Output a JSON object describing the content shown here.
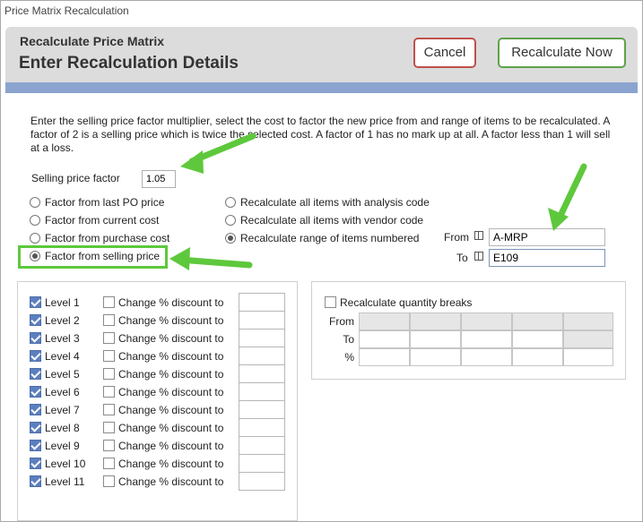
{
  "window": {
    "title": "Price Matrix Recalculation"
  },
  "header": {
    "subtitle": "Recalculate Price Matrix",
    "title": "Enter Recalculation Details",
    "cancel_label": "Cancel",
    "recalc_label": "Recalculate Now"
  },
  "instructions": "Enter the selling price factor multiplier, select the cost to factor the new price from and range of items to be recalculated. A factor of 2 is a selling price which is twice the selected cost. A factor of 1 has no mark up at all. A factor less than 1 will sell at a loss.",
  "selling_price": {
    "label": "Selling price factor",
    "value": "1.05"
  },
  "cost_options": [
    {
      "label": "Factor from last PO price",
      "selected": false
    },
    {
      "label": "Factor from current cost",
      "selected": false
    },
    {
      "label": "Factor from purchase cost",
      "selected": false
    },
    {
      "label": "Factor from selling price",
      "selected": true
    }
  ],
  "range_options": [
    {
      "label": "Recalculate all items with analysis code",
      "selected": false
    },
    {
      "label": "Recalculate all items with vendor code",
      "selected": false
    },
    {
      "label": "Recalculate range of items numbered",
      "selected": true
    }
  ],
  "range": {
    "from_label": "From",
    "from_value": "A-MRP",
    "to_label": "To",
    "to_value": "E109"
  },
  "levels": [
    {
      "label": "Level 1",
      "discount_label": "Change % discount to",
      "value": ""
    },
    {
      "label": "Level 2",
      "discount_label": "Change % discount to",
      "value": ""
    },
    {
      "label": "Level 3",
      "discount_label": "Change % discount to",
      "value": ""
    },
    {
      "label": "Level 4",
      "discount_label": "Change % discount to",
      "value": ""
    },
    {
      "label": "Level 5",
      "discount_label": "Change % discount to",
      "value": ""
    },
    {
      "label": "Level 6",
      "discount_label": "Change % discount to",
      "value": ""
    },
    {
      "label": "Level 7",
      "discount_label": "Change % discount to",
      "value": ""
    },
    {
      "label": "Level 8",
      "discount_label": "Change % discount to",
      "value": ""
    },
    {
      "label": "Level 9",
      "discount_label": "Change % discount to",
      "value": ""
    },
    {
      "label": "Level 10",
      "discount_label": "Change % discount to",
      "value": ""
    },
    {
      "label": "Level 11",
      "discount_label": "Change % discount to",
      "value": ""
    }
  ],
  "quantity_breaks": {
    "label": "Recalculate quantity breaks",
    "rows": [
      "From",
      "To",
      "%"
    ]
  },
  "colors": {
    "accent_bar": "#8aa4cf",
    "cancel_border": "#c0504d",
    "recalc_border": "#5ea24a",
    "annotation_green": "#5ec83c",
    "checkbox": "#5b7fbf"
  }
}
